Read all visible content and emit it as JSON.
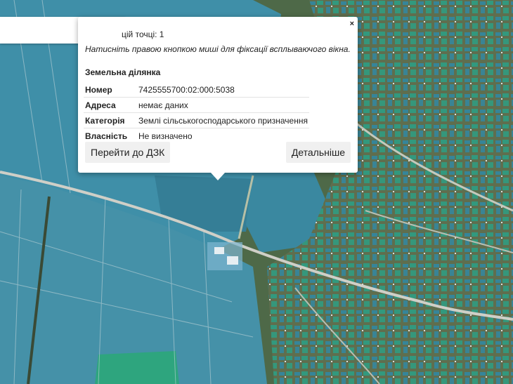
{
  "popup": {
    "count_text": "цій точці: 1",
    "hint": "Натисніть правою кнопкою миші для фіксації всплываючого вікна.",
    "title": "Земельна ділянка",
    "close_label": "×",
    "rows": [
      {
        "key": "Номер",
        "value": "7425555700:02:000:5038"
      },
      {
        "key": "Адреса",
        "value": "немає даних"
      },
      {
        "key": "Категорія",
        "value": "Землі сільськогосподарського призначення"
      },
      {
        "key": "Власність",
        "value": "Не визначено"
      }
    ],
    "btn_dzk": "Перейти до ДЗК",
    "btn_details": "Детальніше"
  },
  "toolbar": {
    "info_icon": "info-icon"
  }
}
